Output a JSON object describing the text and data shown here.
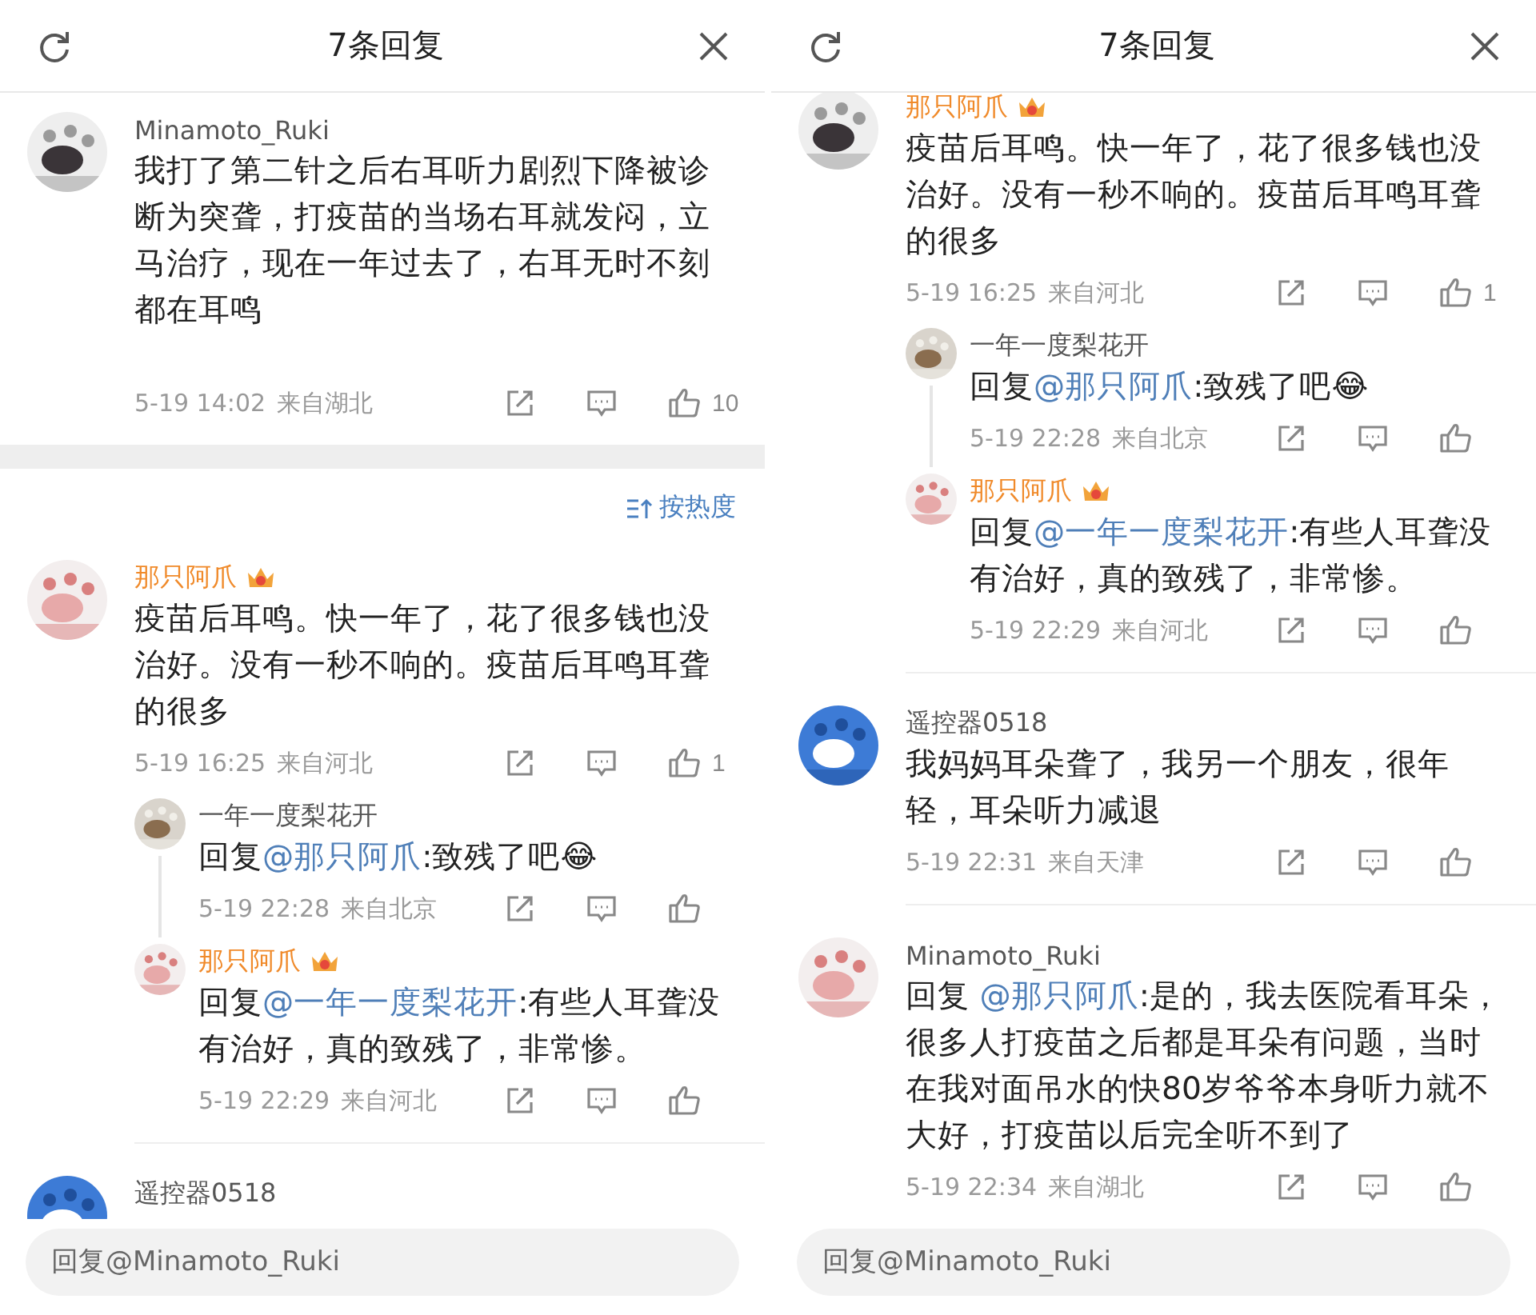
{
  "panels": [
    {
      "title": "7条回复",
      "main_post": {
        "author": "Minamoto_Ruki",
        "vip": false,
        "text": "我打了第二针之后右耳听力剧烈下降被诊断为突聋，打疫苗的当场右耳就发闷，立马治疗，现在一年过去了，右耳无时不刻都在耳鸣",
        "time": "5-19 14:02",
        "location": "来自湖北",
        "likes": "10"
      },
      "sort_label": "按热度",
      "comments": [
        {
          "author": "那只阿爪",
          "vip": true,
          "text": "疫苗后耳鸣。快一年了，花了很多钱也没治好。没有一秒不响的。疫苗后耳鸣耳聋的很多",
          "time": "5-19 16:25",
          "location": "来自河北",
          "likes": "1",
          "replies": [
            {
              "author": "一年一度梨花开",
              "vip": false,
              "prefix": "回复",
              "mention": "@那只阿爪",
              "text": ":致残了吧😂",
              "time": "5-19 22:28",
              "location": "来自北京"
            },
            {
              "author": "那只阿爪",
              "vip": true,
              "prefix": "回复",
              "mention": "@一年一度梨花开",
              "text": ":有些人耳聋没有治好，真的致残了，非常惨。",
              "time": "5-19 22:29",
              "location": "来自河北"
            }
          ]
        },
        {
          "author": "遥控器0518",
          "vip": false
        }
      ],
      "reply_placeholder": "回复@Minamoto_Ruki"
    },
    {
      "title": "7条回复",
      "comments": [
        {
          "author": "那只阿爪",
          "vip": true,
          "text": "疫苗后耳鸣。快一年了，花了很多钱也没治好。没有一秒不响的。疫苗后耳鸣耳聋的很多",
          "time": "5-19 16:25",
          "location": "来自河北",
          "likes": "1",
          "replies": [
            {
              "author": "一年一度梨花开",
              "vip": false,
              "prefix": "回复",
              "mention": "@那只阿爪",
              "text": ":致残了吧😂",
              "time": "5-19 22:28",
              "location": "来自北京"
            },
            {
              "author": "那只阿爪",
              "vip": true,
              "prefix": "回复",
              "mention": "@一年一度梨花开",
              "text": ":有些人耳聋没有治好，真的致残了，非常惨。",
              "time": "5-19 22:29",
              "location": "来自河北"
            }
          ]
        },
        {
          "author": "遥控器0518",
          "vip": false,
          "text": "我妈妈耳朵聋了，我另一个朋友，很年轻，耳朵听力减退",
          "time": "5-19 22:31",
          "location": "来自天津"
        },
        {
          "author": "Minamoto_Ruki",
          "vip": false,
          "prefix": "回复 ",
          "mention": "@那只阿爪",
          "text": ":是的，我去医院看耳朵，很多人打疫苗之后都是耳朵有问题，当时在我对面吊水的快80岁爷爷本身听力就不大好，打疫苗以后完全听不到了",
          "time": "5-19 22:34",
          "location": "来自湖北"
        }
      ],
      "reply_placeholder": "回复@Minamoto_Ruki"
    }
  ]
}
